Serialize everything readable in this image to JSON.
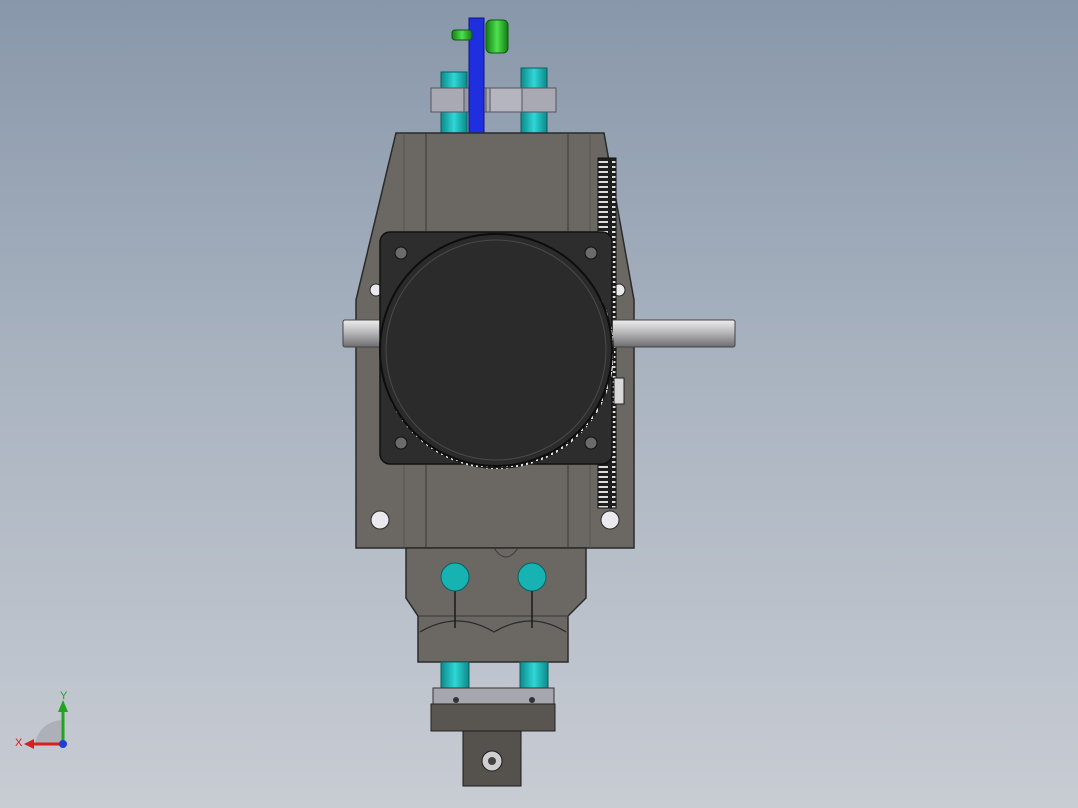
{
  "view": {
    "background_top": "#8897aa",
    "background_bottom": "#c8ccd3"
  },
  "model": {
    "housing_color": "#6b6863",
    "motor_color": "#2b2b2b",
    "shaft_color": "#b9b9bb",
    "rod_color": "#17b3b3",
    "handle_color": "#1f2fe0",
    "knob_color": "#22b522",
    "gear_color": "#222222"
  },
  "triad": {
    "x_label": "X",
    "y_label": "Y",
    "x_color": "#d61f1f",
    "y_color": "#1fa51f",
    "z_color": "#1f3fd6"
  }
}
